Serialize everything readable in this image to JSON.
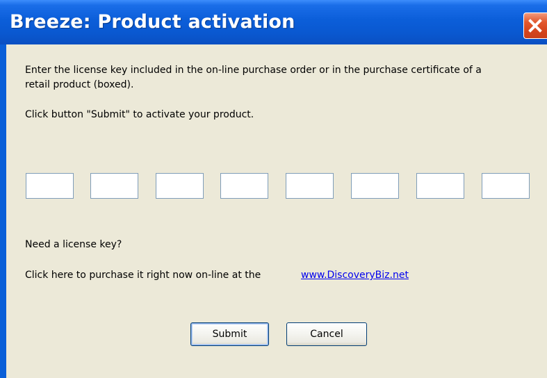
{
  "window": {
    "title": "Breeze: Product activation"
  },
  "icons": {
    "close": "close-icon"
  },
  "instructions": {
    "line1": "Enter the license key included in the on-line purchase order or in the purchase certificate of a",
    "line2": "retail product (boxed).",
    "line3": "Click button \"Submit\" to activate your product."
  },
  "license_key": {
    "fields": [
      "",
      "",
      "",
      "",
      "",
      "",
      "",
      ""
    ]
  },
  "purchase": {
    "prompt": "Need a license key?",
    "text": "Click here to purchase it right now on-line at the",
    "link_label": "www.DiscoveryBiz.net"
  },
  "buttons": {
    "submit_label": "Submit",
    "cancel_label": "Cancel"
  },
  "colors": {
    "titlebar": "#0a5fd8",
    "client_background": "#ece9d8",
    "close_button": "#d5451d",
    "link": "#0000ee",
    "input_border": "#7f9db9"
  }
}
